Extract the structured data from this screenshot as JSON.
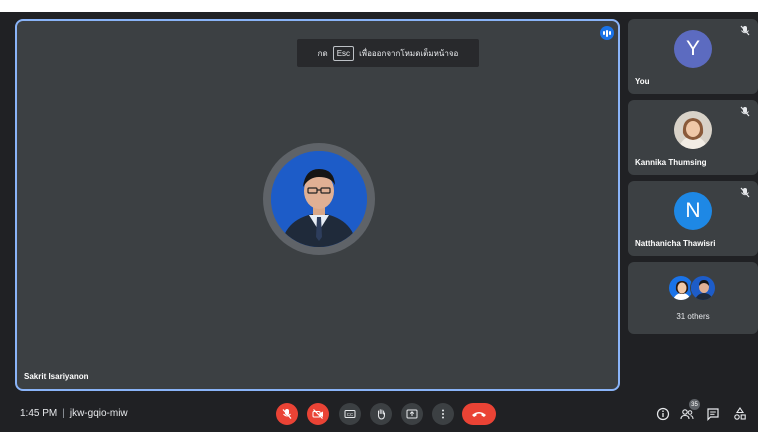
{
  "colors": {
    "background": "#202124",
    "tile": "#3c4043",
    "active_border": "#8ab4f8",
    "danger": "#ea4335",
    "speaking": "#1a73e8"
  },
  "main_tile": {
    "hint": {
      "prefix": "กด",
      "key": "Esc",
      "suffix": "เพื่อออกจากโหมดเต็มหน้าจอ"
    },
    "speaker_name": "Sakrit Isariyanon",
    "speaking_icon": "audio-level-icon"
  },
  "participants": [
    {
      "name": "You",
      "avatar_letter": "Y",
      "avatar_color": "#5c6bc0",
      "mic_icon": "mic-off-icon"
    },
    {
      "name": "Kannika Thumsing",
      "avatar": "photo",
      "mic_icon": "mic-off-icon"
    },
    {
      "name": "Natthanicha Thawisri",
      "avatar_letter": "N",
      "avatar_color": "#1e88e5",
      "mic_icon": "mic-off-icon"
    }
  ],
  "others": {
    "label": "31 others"
  },
  "bottom_bar": {
    "time": "1:45 PM",
    "separator": "|",
    "meeting_code": "jkw-gqio-miw",
    "controls": [
      {
        "name": "mic-off-icon",
        "label": "Turn on microphone"
      },
      {
        "name": "camera-off-icon",
        "label": "Turn on camera"
      },
      {
        "name": "captions-icon",
        "label": "Turn on captions"
      },
      {
        "name": "raise-hand-icon",
        "label": "Raise hand"
      },
      {
        "name": "present-icon",
        "label": "Present now"
      },
      {
        "name": "more-options-icon",
        "label": "More options"
      },
      {
        "name": "hang-up-icon",
        "label": "Leave call"
      }
    ],
    "people_count": "35",
    "right_icons": [
      "info-icon",
      "people-icon",
      "chat-icon",
      "activities-icon"
    ]
  }
}
